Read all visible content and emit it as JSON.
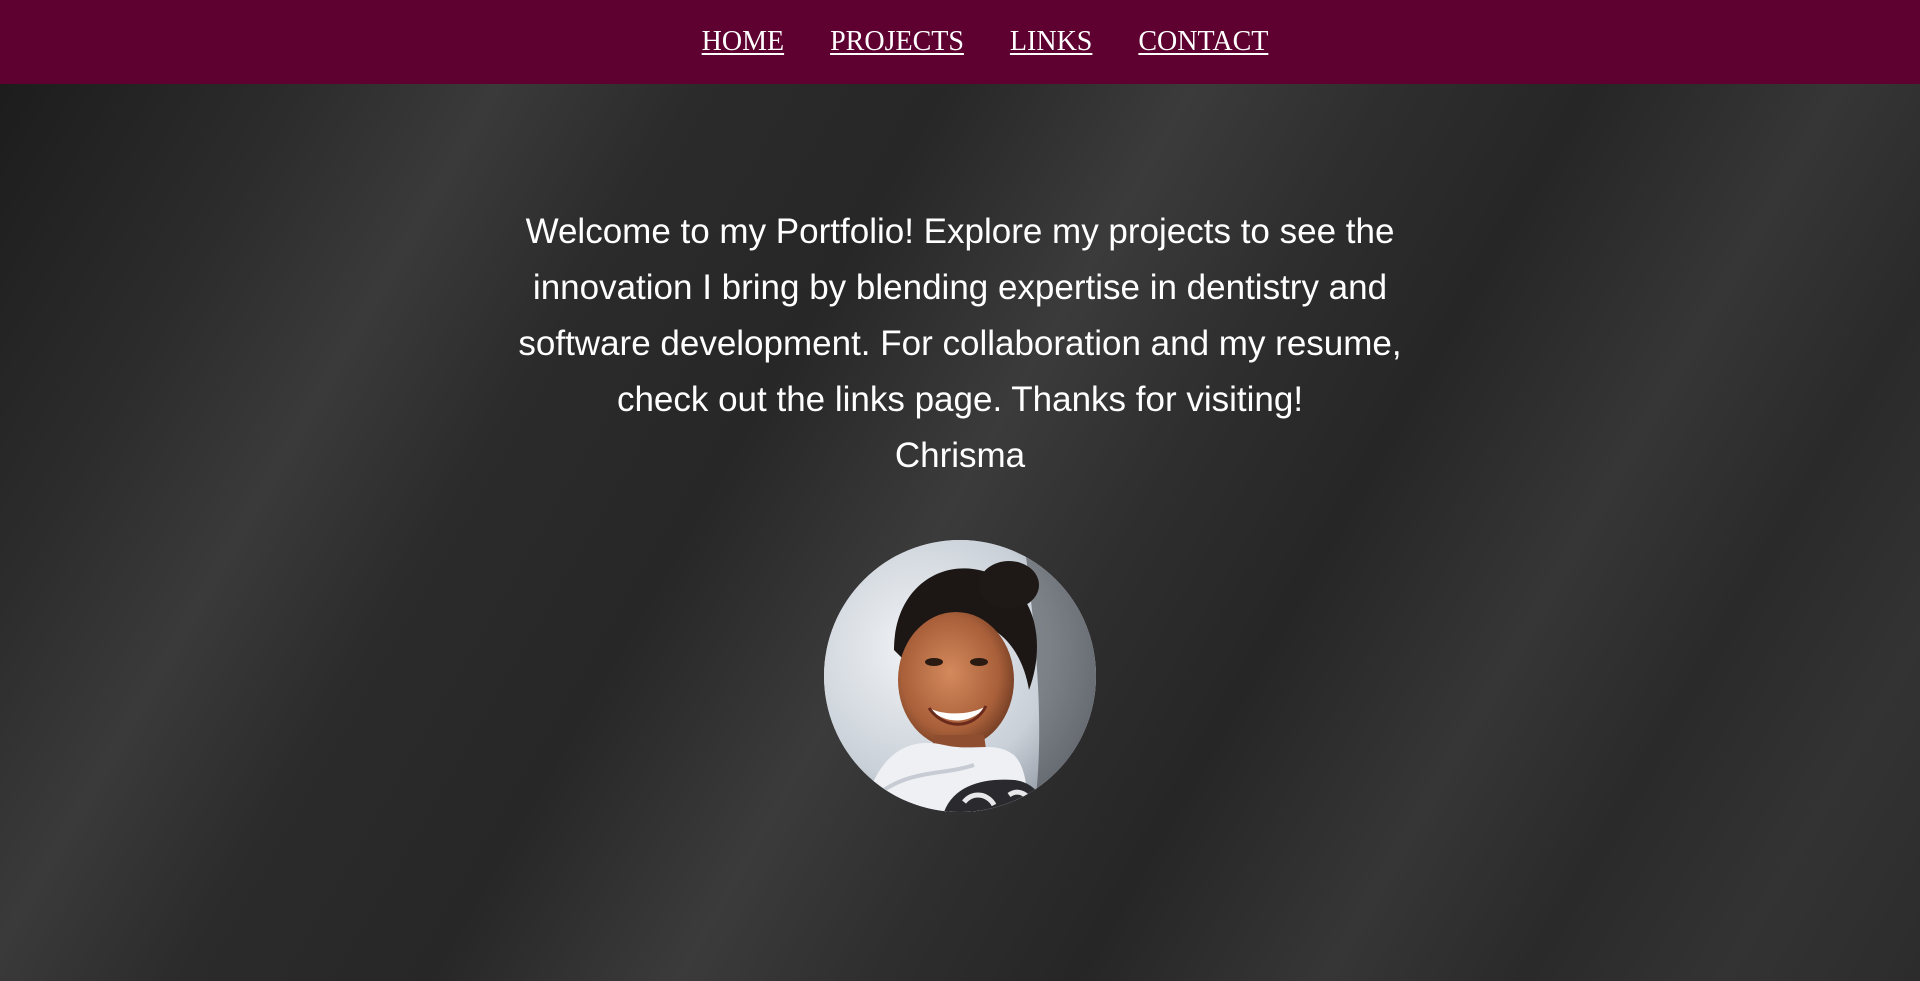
{
  "nav": {
    "items": [
      {
        "label": "HOME"
      },
      {
        "label": "PROJECTS"
      },
      {
        "label": "LINKS"
      },
      {
        "label": "CONTACT"
      }
    ],
    "background_color": "#5e0030"
  },
  "hero": {
    "intro_text": "Welcome to my Portfolio! Explore my projects to see the innovation I bring by blending expertise in dentistry and software development. For collaboration and my resume, check out the links page. Thanks for visiting!",
    "signature": "Chrisma",
    "avatar_description": "profile-photo"
  },
  "colors": {
    "text": "#ffffff",
    "page_background": "#2a2a2a"
  }
}
